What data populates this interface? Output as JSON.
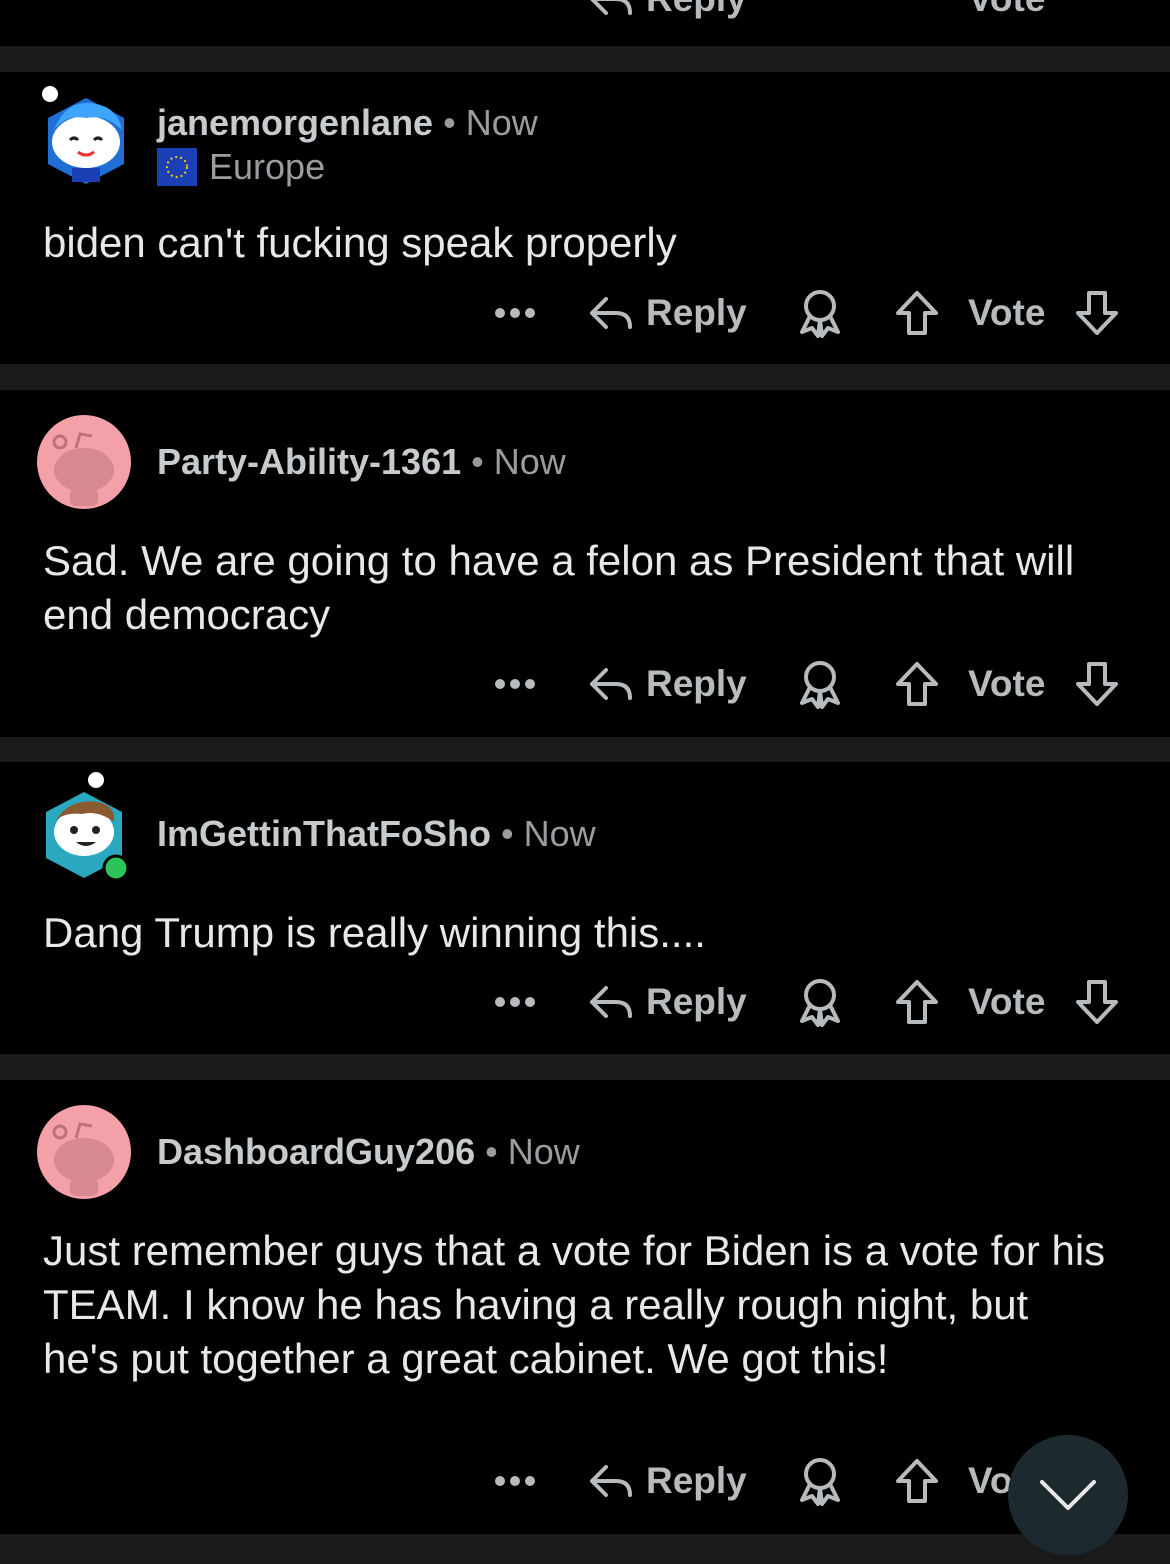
{
  "comments": [
    {
      "user": "janemorgenlane",
      "time": "Now",
      "flair": "Europe",
      "body": "biden can't fucking speak properly",
      "actions": {
        "reply": "Reply",
        "vote": "Vote"
      }
    },
    {
      "user": "Party-Ability-1361",
      "time": "Now",
      "body": "Sad. We are going to have a felon as President that will end democracy",
      "actions": {
        "reply": "Reply",
        "vote": "Vote"
      }
    },
    {
      "user": "ImGettinThatFoSho",
      "time": "Now",
      "body": "Dang Trump is really winning this....",
      "actions": {
        "reply": "Reply",
        "vote": "Vote"
      }
    },
    {
      "user": "DashboardGuy206",
      "time": "Now",
      "body": "Just remember guys that a vote for Biden is a vote for his TEAM.  I know he has having a really rough night, but he's put together a great cabinet.  We got this!",
      "actions": {
        "reply": "Reply",
        "vote": "Vo"
      }
    }
  ],
  "top_partial": {
    "reply": "Reply",
    "vote": "Vote"
  },
  "separator": "•",
  "icons": [
    "more-icon",
    "reply-icon",
    "award-icon",
    "upvote-icon",
    "downvote-icon",
    "chevron-down-icon"
  ],
  "colors": {
    "background": "#000000",
    "separator": "#1a1a1b",
    "avatar_pink": "#f4a0a8",
    "fab": "#1c2a30",
    "online": "#2bc45a"
  }
}
